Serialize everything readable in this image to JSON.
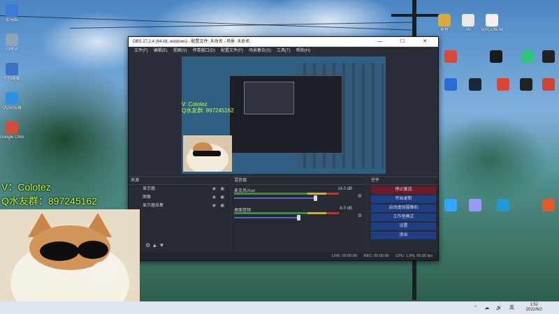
{
  "desktop_left_icons": [
    {
      "label": "此电脑",
      "icon": "monitor-icon",
      "color": "#3a7bd5"
    },
    {
      "label": "回收站",
      "icon": "recycle-bin-icon",
      "color": "#8aa4b8"
    },
    {
      "label": "控制面板",
      "icon": "control-panel-icon",
      "color": "#3c72c4"
    },
    {
      "label": "QQ浏览器",
      "icon": "qq-browser-icon",
      "color": "#2f8fe0"
    },
    {
      "label": "Google Chro",
      "icon": "chrome-icon",
      "color": "#d64a3a"
    }
  ],
  "desktop_right_icons": [
    {
      "label": "素材",
      "icon": "folder-icon",
      "color": "#d9a93a"
    },
    {
      "label": ".vfs",
      "icon": "file-icon",
      "color": "#e9e9e9"
    },
    {
      "label": "说明文档.txt",
      "icon": "text-file-icon",
      "color": "#f0f0f0"
    },
    {
      "label": "",
      "icon": "chrome-icon",
      "color": "#d64a3a"
    },
    {
      "label": "",
      "icon": "qq-icon",
      "color": "#1a1a1a"
    },
    {
      "label": "",
      "icon": "qq-music-icon",
      "color": "#31c27c"
    },
    {
      "label": "",
      "icon": "obs-icon",
      "color": "#222"
    },
    {
      "label": "",
      "icon": "blizzard-icon",
      "color": "#2a6cd6"
    },
    {
      "label": "",
      "icon": "steam-icon",
      "color": "#1b2838"
    },
    {
      "label": "",
      "icon": "ea-icon",
      "color": "#e2442f"
    },
    {
      "label": "",
      "icon": "epic-icon",
      "color": "#222"
    },
    {
      "label": "",
      "icon": "game-icon",
      "color": "#c43"
    },
    {
      "label": "",
      "icon": "photoshop-icon",
      "color": "#31a8ff"
    },
    {
      "label": "",
      "icon": "premiere-icon",
      "color": "#9999ff"
    },
    {
      "label": "",
      "icon": "media-encoder-icon",
      "color": "#1f9ad6"
    },
    {
      "label": "",
      "icon": "app-icon",
      "color": "#e05a2b"
    }
  ],
  "obs": {
    "title": "OBS 27.2.4 (64-bit, windows) - 配置文件: 未命名 - 场景: 未命名",
    "window_controls": "— ☐ ✕",
    "menu": [
      "文件(F)",
      "编辑(E)",
      "视图(V)",
      "停靠窗口(D)",
      "配置文件(P)",
      "场景集合(S)",
      "工具(T)",
      "帮助(H)"
    ],
    "scene_overlay": [
      "V: Colotez",
      "Q水友群: 897245162"
    ],
    "panels": {
      "scenes_header": "来源",
      "sources_header": "来源",
      "mixer_header": "混音器",
      "controls_header": "控件"
    },
    "mixer": [
      {
        "name": "麦克风/Aux",
        "db": "14.0 dB",
        "level": 0.78
      },
      {
        "name": "桌面音频",
        "db": "-6.0 dB",
        "level": 0.62
      }
    ],
    "sources": [
      "显示器",
      "图像",
      "显示器采集"
    ],
    "controls": [
      "停止推流",
      "开始录制",
      "启动虚拟摄像机",
      "工作室模式",
      "设置",
      "退出"
    ],
    "status": {
      "live": "LIVE: 00:00:00",
      "rec": "REC: 00:00:00",
      "cpu": "CPU: 1.0%, 60.00 fps"
    }
  },
  "overlay_text": [
    "V：Colotez",
    "Q水友群：897245162"
  ],
  "taskbar": {
    "tray_icons": "⌃ ☁ 🔊 英",
    "time": "1:52",
    "date": "2022/6/2"
  }
}
